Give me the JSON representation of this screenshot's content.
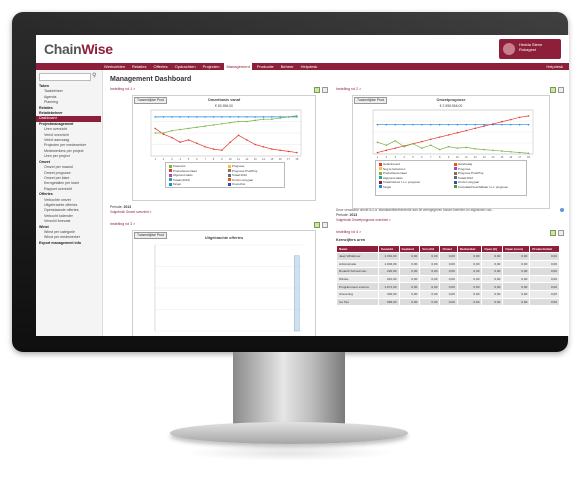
{
  "app": {
    "logo_main": "Chain",
    "logo_accent": "Wise",
    "user_name": "Hedda Stene\nRokagest",
    "help": "Helpdesk"
  },
  "menu": [
    "Werkvelden",
    "Relaties",
    "Offertes",
    "Opdrachten",
    "Projecten",
    "Management",
    "Productie",
    "Beheer",
    "Helpdesk"
  ],
  "menu_active": 5,
  "sidebar": {
    "items": [
      {
        "label": "Taken",
        "type": "group"
      },
      {
        "label": "Taakbeheer",
        "type": "sub"
      },
      {
        "label": "Agenda",
        "type": "sub"
      },
      {
        "label": "Planning",
        "type": "sub"
      },
      {
        "label": "Relaties",
        "type": "group"
      },
      {
        "label": "Relatiebeheer",
        "type": "group"
      },
      {
        "label": "Dashboard",
        "type": "active"
      },
      {
        "label": "Projectmanagement",
        "type": "group"
      },
      {
        "label": "Uren overzicht",
        "type": "sub"
      },
      {
        "label": "Verlof overzicht",
        "type": "sub"
      },
      {
        "label": "Verlof aanvraag",
        "type": "sub"
      },
      {
        "label": "Projecten per medewerker",
        "type": "sub"
      },
      {
        "label": "Medewerkers per project",
        "type": "sub"
      },
      {
        "label": "Uren per project",
        "type": "sub"
      },
      {
        "label": "Omzet",
        "type": "group"
      },
      {
        "label": "Omzet per maand",
        "type": "sub"
      },
      {
        "label": "Omzet prognose",
        "type": "sub"
      },
      {
        "label": "Omzet per klant",
        "type": "sub"
      },
      {
        "label": "Kerngetallen per klant",
        "type": "sub"
      },
      {
        "label": "Rapport overzicht",
        "type": "sub"
      },
      {
        "label": "Offertes",
        "type": "group"
      },
      {
        "label": "Verkochte omzet",
        "type": "sub"
      },
      {
        "label": "Uitgebrachte offertes",
        "type": "sub"
      },
      {
        "label": "Openstaande offertes",
        "type": "sub"
      },
      {
        "label": "Verkocht kalender",
        "type": "sub"
      },
      {
        "label": "Verschil forecast",
        "type": "sub"
      },
      {
        "label": "Winst",
        "type": "group"
      },
      {
        "label": "Winst per categorie",
        "type": "sub"
      },
      {
        "label": "Winst per medewerker",
        "type": "sub"
      },
      {
        "label": "Export management info",
        "type": "group"
      }
    ]
  },
  "page": {
    "title": "Management Dashboard"
  },
  "panels": {
    "p1": {
      "link": "Instelling rol 1 >",
      "filter": "Tussentijdse Prod",
      "title": "Omzetbasis vanaf",
      "subtitle": "€ 80.556,00",
      "periode_label": "Periode:",
      "periode_value": "2013",
      "footer_link": "Volgebruik Omzet overzicht >",
      "legend": [
        {
          "label": "Toekomst",
          "color": "#7cb342"
        },
        {
          "label": "Productievoorraad",
          "color": "#e53935"
        },
        {
          "label": "Afgerond saldo",
          "color": "#ab47bc"
        },
        {
          "label": "Totaal (2013)",
          "color": "#26a69a"
        },
        {
          "label": "Target",
          "color": "#1e88e5"
        },
        {
          "label": "Prognose",
          "color": "#fbc02d"
        },
        {
          "label": "Prognose Prod/Proj",
          "color": "#8d6e63"
        },
        {
          "label": "Totaal 2012",
          "color": "#546e7a"
        },
        {
          "label": "Omzet vorig jaar",
          "color": "#f4511e"
        },
        {
          "label": "Overschot",
          "color": "#3949ab"
        }
      ]
    },
    "p2": {
      "link": "Instelling rol 2 >",
      "filter": "Tussentijdse Prod",
      "title": "Omzetprognose",
      "subtitle": "€ 2.598.566,00",
      "periode_label": "Periode:",
      "periode_value": "2013",
      "footer_link": "Volgebruik Omzetprognose overzicht >",
      "note": "Deze verwachte omzet is o.a. standaardberekenende aan de weergegeven tussen tweeden en afgesloten van...",
      "legend": [
        {
          "label": "Gefactureerd",
          "color": "#e53935"
        },
        {
          "label": "Nog te factureren",
          "color": "#fbc02d"
        },
        {
          "label": "Productievoorraad",
          "color": "#7cb342"
        },
        {
          "label": "Afgerond saldo",
          "color": "#26a69a"
        },
        {
          "label": "Totaal factuur t.o.v. prognose",
          "color": "#8e1f3b"
        },
        {
          "label": "Target",
          "color": "#1e88e5"
        },
        {
          "label": "Handmatig",
          "color": "#f4511e"
        },
        {
          "label": "Prognose",
          "color": "#ab47bc"
        },
        {
          "label": "Prognose Prod/Proj",
          "color": "#8d6e63"
        },
        {
          "label": "Totaal 2012",
          "color": "#546e7a"
        },
        {
          "label": "Omzet vorig jaar",
          "color": "#3949ab"
        },
        {
          "label": "Cumulatief beschikbaar t.o.v. prognose",
          "color": "#43a047"
        }
      ]
    },
    "p3": {
      "link": "Instelling rol 3 >",
      "filter": "Tussentijdse Prod",
      "title": "Uitgebrachte offertes"
    },
    "p4": {
      "link": "Instelling rol 4 >",
      "table_title": "Kerncijfers uren",
      "headers": [
        "Naam",
        "Gewerkt",
        "Gepland",
        "Verschil",
        "Omzet",
        "Declarabel",
        "Open (€)",
        "Open (uren)",
        "Productiviteit"
      ],
      "group_header": "Facturatie",
      "rows": [
        [
          "Jaap Wildeboer",
          "1.391,00",
          "0,00",
          "0,00",
          "0,00",
          "0,00",
          "0,00",
          "0,00",
          "0,00"
        ],
        [
          "Adminstratie",
          "1.002,00",
          "0,00",
          "0,00",
          "0,00",
          "0,00",
          "0,00",
          "0,00",
          "0,00"
        ],
        [
          "Roderik Schuurman",
          "220,00",
          "0,00",
          "0,00",
          "0,00",
          "0,00",
          "0,00",
          "0,00",
          "0,00"
        ],
        [
          "Windie",
          "910,00",
          "0,00",
          "0,00",
          "0,00",
          "0,00",
          "0,00",
          "0,00",
          "0,00"
        ],
        [
          "Programmeur externe",
          "1.671,00",
          "0,00",
          "0,00",
          "0,00",
          "0,00",
          "0,00",
          "0,00",
          "0,00"
        ],
        [
          "Uitvoering",
          "320,00",
          "0,00",
          "0,00",
          "0,00",
          "0,00",
          "0,00",
          "0,00",
          "0,00"
        ],
        [
          "Ivo Tas",
          "996,00",
          "0,00",
          "0,00",
          "0,00",
          "0,00",
          "0,00",
          "0,00",
          "0,00"
        ]
      ]
    }
  },
  "chart_data": [
    {
      "type": "line",
      "title": "Omzetbasis vanaf",
      "subtitle": "€ 80.556,00",
      "x": [
        "1",
        "2",
        "3",
        "4",
        "5",
        "6",
        "7",
        "8",
        "9",
        "10",
        "11",
        "12",
        "13",
        "14",
        "15",
        "16",
        "17",
        "18"
      ],
      "ylim": [
        0,
        200000
      ],
      "series": [
        {
          "name": "Target",
          "values": [
            170000,
            170000,
            170000,
            170000,
            170000,
            170000,
            170000,
            170000,
            170000,
            170000,
            170000,
            170000,
            170000,
            170000,
            170000,
            170000,
            170000,
            170000
          ]
        },
        {
          "name": "Toekomst",
          "values": [
            120000,
            95000,
            80000,
            60000,
            70000,
            55000,
            40000,
            30000,
            25000,
            60000,
            90000,
            70000,
            50000,
            40000,
            30000,
            25000,
            20000,
            15000
          ]
        },
        {
          "name": "Prognose",
          "values": [
            100000,
            100000,
            110000,
            115000,
            120000,
            125000,
            130000,
            135000,
            140000,
            145000,
            150000,
            150000,
            155000,
            160000,
            160000,
            165000,
            170000,
            175000
          ]
        }
      ]
    },
    {
      "type": "line",
      "title": "Omzetprognose",
      "subtitle": "€ 2.598.566,00",
      "x": [
        "1",
        "2",
        "3",
        "4",
        "5",
        "6",
        "7",
        "8",
        "9",
        "10",
        "11",
        "12",
        "13",
        "14",
        "15",
        "16",
        "17",
        "18"
      ],
      "ylim": [
        0,
        3000000
      ],
      "series": [
        {
          "name": "Target",
          "values": [
            2000000,
            2000000,
            2000000,
            2000000,
            2000000,
            2000000,
            2000000,
            2000000,
            2000000,
            2000000,
            2000000,
            2000000,
            2000000,
            2000000,
            2000000,
            2000000,
            2000000,
            2000000
          ]
        },
        {
          "name": "Totaal factuur t.o.v. prognose",
          "values": [
            100000,
            250000,
            400000,
            550000,
            700000,
            850000,
            1000000,
            1150000,
            1300000,
            1450000,
            1600000,
            1750000,
            1900000,
            2050000,
            2200000,
            2350000,
            2500000,
            2600000
          ]
        },
        {
          "name": "Gefactureerd",
          "values": [
            800000,
            600000,
            900000,
            500000,
            700000,
            400000,
            600000,
            300000,
            500000,
            400000,
            450000,
            350000,
            300000,
            250000,
            200000,
            150000,
            100000,
            50000
          ]
        }
      ]
    },
    {
      "type": "bar",
      "title": "Uitgebrachte offertes",
      "categories": [
        "1",
        "2",
        "3",
        "4",
        "5",
        "6",
        "7",
        "8",
        "9",
        "10",
        "11",
        "12"
      ],
      "values": [
        0,
        0,
        0,
        0,
        0,
        0,
        0,
        0,
        0,
        0,
        0,
        7
      ]
    }
  ]
}
